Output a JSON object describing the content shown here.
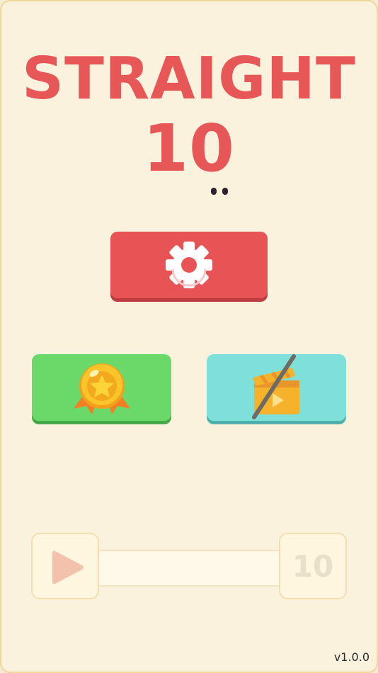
{
  "title": {
    "line1": "STRAIGHT",
    "line2": "10"
  },
  "buttons": {
    "settings": {
      "icon": "gear-icon",
      "color": "#e85456"
    },
    "achievements": {
      "icon": "medal-icon",
      "color": "#6bd96a"
    },
    "remove_ads": {
      "icon": "clapperboard-crossed-icon",
      "color": "#7fe0da"
    }
  },
  "play_bar": {
    "play_icon": "play-icon",
    "level": "10"
  },
  "footer": {
    "version": "v1.0.0"
  },
  "colors": {
    "background": "#faf2dd",
    "accent": "#e85758"
  }
}
